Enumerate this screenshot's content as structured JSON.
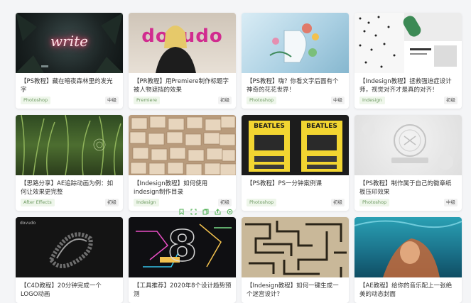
{
  "cards": [
    {
      "title": "【PS教程】藏在暗夜森林里的发光字",
      "tag": "Photoshop",
      "level": "中级",
      "thumb_text": "write"
    },
    {
      "title": "【PR教程】用Premiere制作标题字被人物遮挡的效果",
      "tag": "Premiere",
      "level": "初级",
      "thumb_text": "dovudo"
    },
    {
      "title": "【PS教程】嗨？你看文字后面有个神奇的花花世界！",
      "tag": "Photoshop",
      "level": "中级",
      "thumb_text": ""
    },
    {
      "title": "【Indesign教程】拯救强迫症设计师，视觉对齐才是真的对齐！",
      "tag": "Indesign",
      "level": "初级",
      "thumb_text": ""
    },
    {
      "title": "【思路分享】AE追踪动画为例：如何让效果更完整",
      "tag": "After Effects",
      "level": "初级",
      "thumb_text": ""
    },
    {
      "title": "【Indesign教程】如何使用indesign制作目录",
      "tag": "Indesign",
      "level": "初级",
      "thumb_text": ""
    },
    {
      "title": "【PS教程】PS一分钟案例课",
      "tag": "Photoshop",
      "level": "初级",
      "thumb_text": "BEATLES"
    },
    {
      "title": "【PS教程】制作属于自己的徽章纸板压印效果",
      "tag": "Photoshop",
      "level": "中级",
      "thumb_text": ""
    },
    {
      "title": "【C4D教程】20分钟完成一个LOGO动画",
      "tag": "",
      "level": "",
      "thumb_text": "dovudo"
    },
    {
      "title": "【工具推荐】2020年8个设计趋势预测",
      "tag": "",
      "level": "",
      "thumb_text": "8"
    },
    {
      "title": "【Indesign教程】如何一键生成一个迷宫设计？",
      "tag": "",
      "level": "",
      "thumb_text": ""
    },
    {
      "title": "【AE教程】给你的音乐配上一张绝美的动态封面",
      "tag": "",
      "level": "",
      "thumb_text": ""
    }
  ],
  "toolbar": {
    "icons": [
      "bookmark-icon",
      "expand-icon",
      "copy-icon",
      "share-icon",
      "settings-icon"
    ],
    "color": "#4caf50"
  },
  "colors": {
    "tag_bg": "#eef6ea",
    "tag_text": "#6f9a63",
    "level_bg": "#f2f2f2"
  }
}
